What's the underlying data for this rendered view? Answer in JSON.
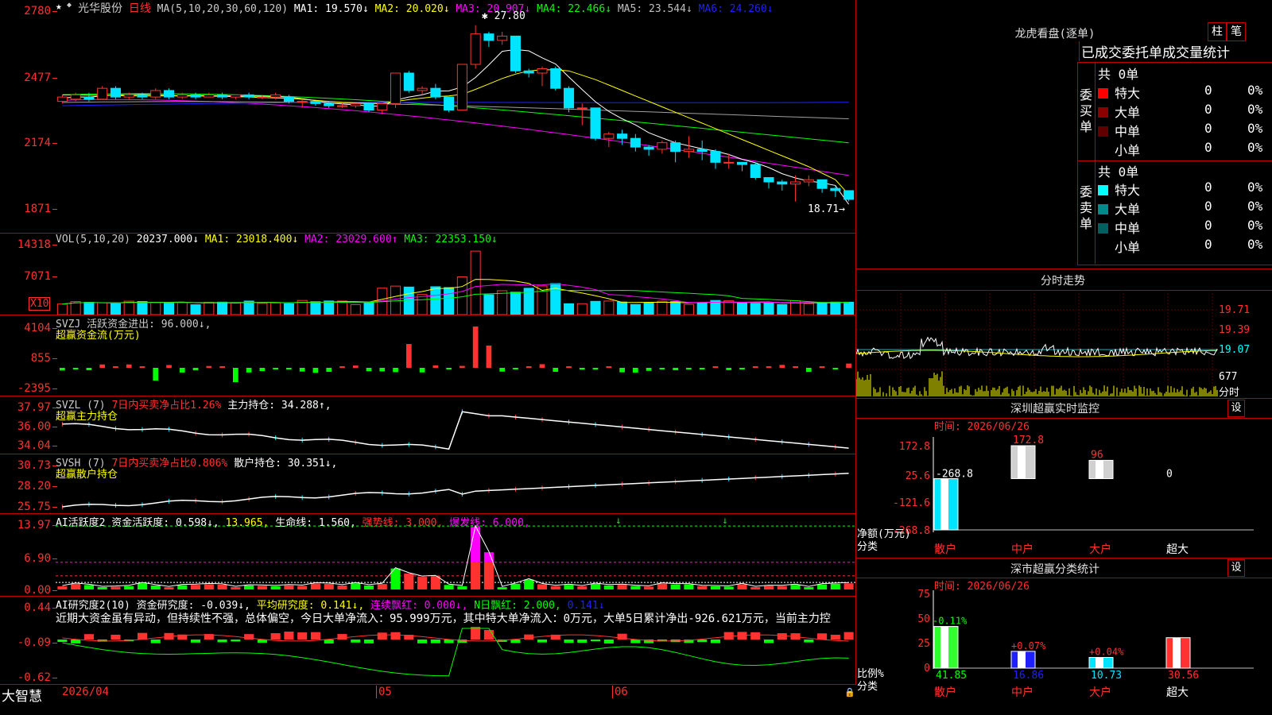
{
  "colors": {
    "up": "#ff3232",
    "down": "#00e5ff",
    "grid": "#c00000",
    "yellow": "#ffff00",
    "green": "#00ff00",
    "magenta": "#ff00ff",
    "white": "#ffffff",
    "blue": "#2020ff"
  },
  "main": {
    "stock_name": "光华股份",
    "period": "日线",
    "ma_header": "MA(5,10,20,30,60,120)",
    "ma": [
      {
        "label": "MA1: 19.570↓",
        "color": "#ffffff"
      },
      {
        "label": "MA2: 20.020↓",
        "color": "#ffff00"
      },
      {
        "label": "MA3: 20.907↓",
        "color": "#ff00ff"
      },
      {
        "label": "MA4: 22.466↓",
        "color": "#00ff00"
      },
      {
        "label": "MA5: 23.544↓",
        "color": "#c0c0c0"
      },
      {
        "label": "MA6: 24.260↓",
        "color": "#2020ff"
      }
    ],
    "yticks": [
      "2780",
      "2477",
      "2174",
      "1871"
    ],
    "high_label": "27.80",
    "low_label": "18.71"
  },
  "vol": {
    "header": "VOL(5,10,20)",
    "v": "20237.000↓",
    "ma1": "MA1: 23018.400↓",
    "ma2": "MA2: 23029.600↑",
    "ma3": "MA3: 22353.150↓",
    "yticks": [
      "14318",
      "7071"
    ],
    "unit": "X10"
  },
  "svzj": {
    "header": "SVZJ  活跃资金进出: 96.000↓,",
    "sub": "超赢资金流(万元)",
    "yticks": [
      "4104",
      "855",
      "-2395"
    ]
  },
  "svzl": {
    "header1": "SVZL (7)",
    "header2": "7日内买卖净占比1.26%",
    "header3": "主力持仓: 34.288↑,",
    "sub": "超赢主力持仓",
    "yticks": [
      "37.97",
      "36.00",
      "34.04"
    ]
  },
  "svsh": {
    "header1": "SVSH (7)",
    "header2": "7日内买卖净占比0.806%",
    "header3": "散户持仓: 30.351↓,",
    "sub": "超赢散户持仓",
    "yticks": [
      "30.73",
      "28.20",
      "25.75"
    ]
  },
  "ai": {
    "h1": "AI活跃度2 资金活跃度: 0.598↓,",
    "h2": "13.965,",
    "h3": "生命线: 1.560,",
    "h4": "强势线: 3.000,",
    "h5": "爆发线: 6.000,",
    "yticks": [
      "13.97",
      "6.90",
      "0.00"
    ]
  },
  "ai2": {
    "h1": "AI研究度2(10) 资金研究度: -0.039↓,",
    "h2": "平均研究度: 0.141↓,",
    "h3": "连续飘红: 0.000↓,",
    "h4": "N日飘红: 2.000,",
    "h5": "0.141↓",
    "commentary": "近期大资金虽有异动，但持续性不强，总体偏空，今日大单净流入：95.999万元，其中特大单净流入：0万元，大单5日累计净出-926.621万元，当前主力控",
    "yticks": [
      "0.44",
      "-0.09",
      "-0.62"
    ]
  },
  "xaxis": {
    "labels": [
      "2026/04",
      "05",
      "06"
    ]
  },
  "brand": "大智慧",
  "right": {
    "lhb_title": "龙虎看盘(逐单)",
    "btn1": "柱",
    "btn2": "笔",
    "stat_title": "已成交委托单成交量统计",
    "buy_side": "委买单",
    "sell_side": "委卖单",
    "buy_total": "共 0单",
    "sell_total": "共 0单",
    "buy_rows": [
      {
        "name": "特大",
        "v": "0",
        "p": "0%",
        "c": "#ff0000"
      },
      {
        "name": "大单",
        "v": "0",
        "p": "0%",
        "c": "#8b0000"
      },
      {
        "name": "中单",
        "v": "0",
        "p": "0%",
        "c": "#600000"
      },
      {
        "name": "小单",
        "v": "0",
        "p": "0%",
        "c": ""
      }
    ],
    "sell_rows": [
      {
        "name": "特大",
        "v": "0",
        "p": "0%",
        "c": "#00ffff"
      },
      {
        "name": "大单",
        "v": "0",
        "p": "0%",
        "c": "#008b8b"
      },
      {
        "name": "中单",
        "v": "0",
        "p": "0%",
        "c": "#006060"
      },
      {
        "name": "小单",
        "v": "0",
        "p": "0%",
        "c": ""
      }
    ],
    "fs_title": "分时走势",
    "fs_ticks": [
      "19.71",
      "19.39",
      "19.07",
      "677"
    ],
    "fs_unit": "分时",
    "sz_title": "深圳超赢实时监控",
    "set": "设",
    "sz_time": "时间: 2026/06/26",
    "sz_ticks": [
      "172.8",
      "25.6",
      "-121.6",
      "-268.8"
    ],
    "sz_values": [
      {
        "label": "-268.8"
      },
      {
        "label": "172.8"
      },
      {
        "label": "96"
      },
      {
        "label": "0"
      }
    ],
    "sz_ylabel": "净额(万元)",
    "sz_xlabel": "分类",
    "cats": [
      "散户",
      "中户",
      "大户",
      "超大"
    ],
    "fl_title": "深市超赢分类统计",
    "fl_time": "时间: 2026/06/26",
    "fl_ticks": [
      "75",
      "50",
      "25",
      "0"
    ],
    "fl_pcts": [
      "-0.11%",
      "+0.07%",
      "+0.04%",
      ""
    ],
    "fl_vals": [
      "41.85",
      "16.86",
      "10.73",
      "30.56"
    ],
    "fl_ylabel": "比例%",
    "fl_xlabel": "分类"
  },
  "chart_data": {
    "type": "candlestick",
    "candles": [
      [
        24.3,
        24.5,
        24.6,
        24.2
      ],
      [
        24.4,
        24.6,
        24.7,
        24.3
      ],
      [
        24.5,
        24.4,
        24.7,
        24.3
      ],
      [
        24.4,
        24.9,
        25.0,
        24.4
      ],
      [
        24.9,
        24.5,
        25.0,
        24.4
      ],
      [
        24.5,
        24.6,
        24.7,
        24.4
      ],
      [
        24.6,
        24.5,
        24.7,
        24.4
      ],
      [
        24.5,
        24.8,
        24.9,
        24.4
      ],
      [
        24.8,
        24.5,
        24.9,
        24.4
      ],
      [
        24.5,
        24.6,
        24.7,
        24.4
      ],
      [
        24.6,
        24.5,
        24.7,
        24.4
      ],
      [
        24.5,
        24.6,
        24.7,
        24.5
      ],
      [
        24.6,
        24.5,
        24.7,
        24.4
      ],
      [
        24.5,
        24.6,
        24.6,
        24.4
      ],
      [
        24.6,
        24.5,
        24.7,
        24.4
      ],
      [
        24.5,
        24.5,
        24.6,
        24.4
      ],
      [
        24.5,
        24.6,
        24.7,
        24.4
      ],
      [
        24.5,
        24.3,
        24.6,
        24.2
      ],
      [
        24.3,
        24.3,
        24.4,
        24.0
      ],
      [
        24.3,
        24.2,
        24.3,
        24.1
      ],
      [
        24.2,
        24.1,
        24.3,
        24.0
      ],
      [
        24.1,
        24.1,
        24.2,
        24.0
      ],
      [
        24.1,
        24.2,
        24.2,
        24.0
      ],
      [
        24.2,
        23.9,
        24.2,
        23.8
      ],
      [
        23.9,
        24.2,
        24.2,
        23.7
      ],
      [
        24.2,
        25.6,
        25.6,
        24.0
      ],
      [
        25.6,
        24.8,
        25.7,
        24.7
      ],
      [
        24.8,
        24.9,
        25.0,
        24.6
      ],
      [
        24.9,
        24.5,
        25.1,
        24.4
      ],
      [
        24.5,
        23.9,
        24.5,
        23.8
      ],
      [
        23.9,
        26.0,
        26.0,
        23.9
      ],
      [
        26.0,
        27.4,
        27.8,
        25.8
      ],
      [
        27.4,
        27.1,
        27.5,
        26.8
      ],
      [
        27.1,
        27.3,
        27.5,
        26.9
      ],
      [
        27.3,
        25.7,
        27.3,
        25.6
      ],
      [
        25.7,
        25.6,
        25.8,
        25.4
      ],
      [
        25.6,
        25.8,
        25.9,
        25.0
      ],
      [
        25.8,
        24.9,
        25.9,
        24.8
      ],
      [
        24.9,
        24.0,
        25.0,
        23.8
      ],
      [
        24.0,
        24.0,
        24.2,
        23.2
      ],
      [
        24.0,
        22.6,
        24.0,
        22.5
      ],
      [
        22.6,
        22.8,
        22.9,
        22.2
      ],
      [
        22.8,
        22.6,
        23.0,
        22.3
      ],
      [
        22.6,
        22.2,
        22.8,
        22.0
      ],
      [
        22.2,
        22.1,
        22.3,
        21.8
      ],
      [
        22.1,
        22.4,
        22.5,
        21.9
      ],
      [
        22.4,
        22.0,
        22.5,
        21.5
      ],
      [
        22.0,
        22.1,
        22.7,
        21.7
      ],
      [
        22.1,
        22.0,
        22.5,
        21.6
      ],
      [
        22.0,
        21.5,
        22.1,
        21.2
      ],
      [
        21.5,
        21.5,
        21.9,
        21.2
      ],
      [
        21.5,
        21.4,
        21.5,
        21.1
      ],
      [
        21.4,
        20.8,
        21.5,
        20.7
      ],
      [
        20.8,
        20.6,
        20.8,
        20.3
      ],
      [
        20.6,
        20.5,
        20.7,
        20.2
      ],
      [
        20.5,
        20.6,
        20.9,
        19.7
      ],
      [
        20.6,
        20.7,
        20.9,
        20.4
      ],
      [
        20.7,
        20.3,
        20.7,
        20.1
      ],
      [
        20.3,
        20.2,
        20.4,
        19.9
      ],
      [
        20.2,
        19.8,
        20.2,
        19.7
      ]
    ],
    "price_range": [
      18.3,
      28.3
    ],
    "ma_series": {
      "MA1": [
        24.45,
        24.5,
        24.5,
        24.55,
        24.6,
        24.6,
        24.62,
        24.6,
        24.58,
        24.55,
        24.58,
        24.56,
        24.55,
        24.55,
        24.54,
        24.54,
        24.52,
        24.5,
        24.42,
        24.33,
        24.23,
        24.18,
        24.14,
        24.09,
        24.08,
        24.35,
        24.5,
        24.6,
        24.77,
        24.78,
        24.96,
        25.4,
        25.98,
        26.6,
        26.68,
        26.62,
        26.3,
        26.02,
        25.42,
        24.84,
        24.28,
        23.84,
        23.5,
        23.22,
        22.86,
        22.62,
        22.4,
        22.26,
        22.12,
        22.02,
        21.86,
        21.64,
        21.48,
        21.26,
        20.98,
        20.78,
        20.64,
        20.56,
        20.44,
        19.57
      ],
      "MA2": [
        24.6,
        24.6,
        24.58,
        24.58,
        24.57,
        24.56,
        24.55,
        24.55,
        24.55,
        24.55,
        24.55,
        24.54,
        24.53,
        24.52,
        24.5,
        24.48,
        24.46,
        24.44,
        24.4,
        24.35,
        24.3,
        24.26,
        24.24,
        24.22,
        24.21,
        24.3,
        24.38,
        24.45,
        24.52,
        24.55,
        24.62,
        24.85,
        25.1,
        25.35,
        25.55,
        25.7,
        25.75,
        25.75,
        25.7,
        25.5,
        25.3,
        25.05,
        24.8,
        24.55,
        24.3,
        24.05,
        23.8,
        23.55,
        23.3,
        23.05,
        22.8,
        22.55,
        22.3,
        22.05,
        21.8,
        21.55,
        21.3,
        21.0,
        20.7,
        20.02
      ]
    }
  }
}
